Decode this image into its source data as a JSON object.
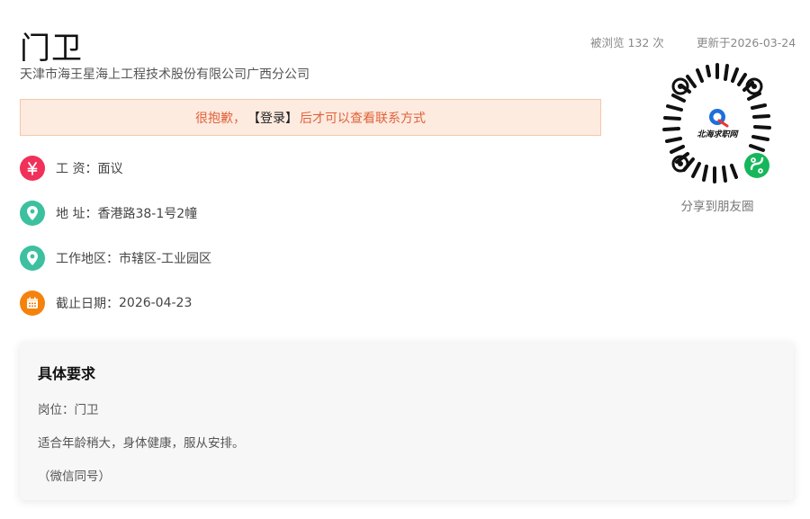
{
  "job": {
    "title": "门卫",
    "company": "天津市海王星海上工程技术股份有限公司广西分公司",
    "views_text": "被浏览 132 次",
    "updated_text": "更新于2026-03-24"
  },
  "notice": {
    "prefix": "很抱歉，",
    "login_label": "【登录】",
    "suffix": "后才可以查看联系方式",
    "bg_color": "#fdebe0",
    "text_color": "#e0623a"
  },
  "info": [
    {
      "icon": "yuan-icon",
      "color": "#f0315a",
      "label": "工  资：",
      "value": "面议"
    },
    {
      "icon": "location-icon",
      "color": "#3cc0a0",
      "label": "地  址：",
      "value": "香港路38-1号2幢"
    },
    {
      "icon": "location-icon",
      "color": "#3cc0a0",
      "label": "工作地区：",
      "value": "市辖区-工业园区"
    },
    {
      "icon": "calendar-icon",
      "color": "#f5820d",
      "label": "截止日期：",
      "value": "2026-04-23"
    }
  ],
  "qr": {
    "caption": "分享到朋友圈",
    "logo_text": "北海求职网"
  },
  "requirements": {
    "title": "具体要求",
    "lines": [
      "岗位：门卫",
      "适合年龄稍大，身体健康，服从安排。",
      "（微信同号）"
    ]
  }
}
